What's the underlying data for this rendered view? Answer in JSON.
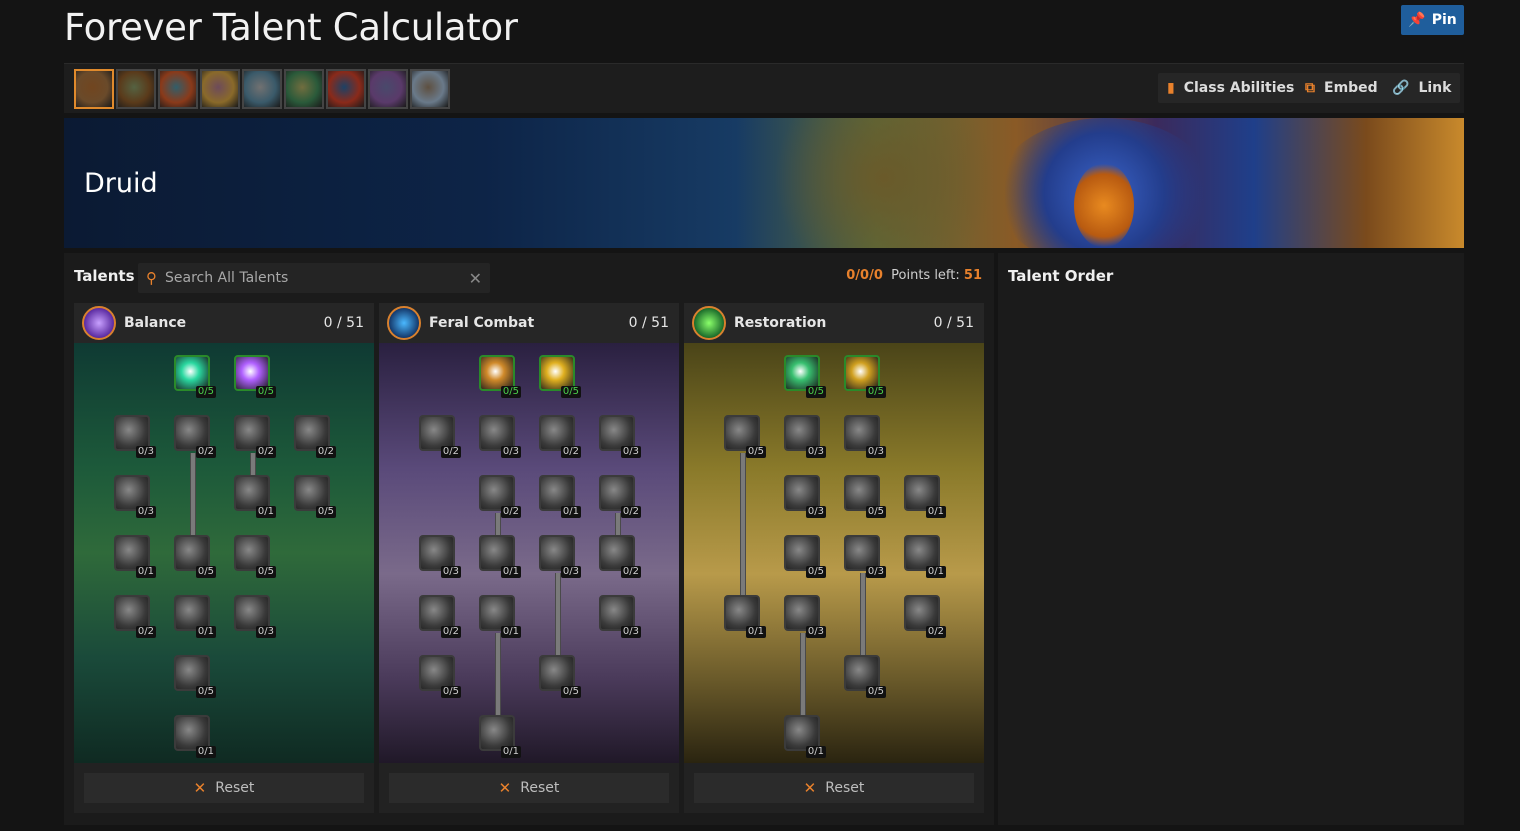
{
  "app": {
    "title": "Forever Talent Calculator",
    "pin_label": "Pin"
  },
  "toolbar": {
    "classes": [
      {
        "name": "Druid",
        "icon": "druid-class-icon",
        "color": "#ff7c0a",
        "selected": true
      },
      {
        "name": "Hunter",
        "icon": "hunter-class-icon",
        "color": "#aad372"
      },
      {
        "name": "Mage",
        "icon": "mage-class-icon",
        "color": "#3fc7eb"
      },
      {
        "name": "Paladin",
        "icon": "paladin-class-icon",
        "color": "#f48cba"
      },
      {
        "name": "Priest",
        "icon": "priest-class-icon",
        "color": "#ffffff"
      },
      {
        "name": "Rogue",
        "icon": "rogue-class-icon",
        "color": "#fff468"
      },
      {
        "name": "Shaman",
        "icon": "shaman-class-icon",
        "color": "#0070dd"
      },
      {
        "name": "Warlock",
        "icon": "warlock-class-icon",
        "color": "#8788ee"
      },
      {
        "name": "Warrior",
        "icon": "warrior-class-icon",
        "color": "#c69b6d"
      }
    ],
    "class_abilities_label": "Class Abilities",
    "embed_label": "Embed",
    "link_label": "Link"
  },
  "banner": {
    "class_name": "Druid"
  },
  "talents": {
    "label": "Talents",
    "search_placeholder": "Search All Talents",
    "spent": "0/0/0",
    "points_left_label": "Points left:",
    "points_left": "51"
  },
  "order": {
    "label": "Talent Order"
  },
  "trees": [
    {
      "name": "Balance",
      "points": "0 / 51",
      "reset_label": "Reset",
      "icon": "balance-icon",
      "talents": [
        {
          "id": "b1",
          "rank": "0/5",
          "icon": "starlight-wrath-icon",
          "hi": true
        },
        {
          "id": "b2",
          "rank": "0/5",
          "icon": "genesis-icon",
          "hi": true
        },
        {
          "id": "b3",
          "rank": "0/3",
          "icon": "moonglow-icon"
        },
        {
          "id": "b4",
          "rank": "0/2",
          "icon": "natures-reach-icon"
        },
        {
          "id": "b5",
          "rank": "0/2",
          "icon": "improved-moonfire-icon"
        },
        {
          "id": "b6",
          "rank": "0/2",
          "icon": "brambles-icon"
        },
        {
          "id": "b7",
          "rank": "0/3",
          "icon": "natures-grasp-icon"
        },
        {
          "id": "b8",
          "rank": "0/1",
          "icon": "improved-natures-grasp-icon"
        },
        {
          "id": "b9",
          "rank": "0/5",
          "icon": "improved-entangling-roots-icon"
        },
        {
          "id": "b10",
          "rank": "0/1",
          "icon": "insect-swarm-icon"
        },
        {
          "id": "b11",
          "rank": "0/5",
          "icon": "natures-focus-icon"
        },
        {
          "id": "b12",
          "rank": "0/5",
          "icon": "vengeance-icon"
        },
        {
          "id": "b13",
          "rank": "0/2",
          "icon": "celestial-focus-icon"
        },
        {
          "id": "b14",
          "rank": "0/1",
          "icon": "lunar-guidance-icon"
        },
        {
          "id": "b15",
          "rank": "0/3",
          "icon": "moonfury-icon"
        },
        {
          "id": "b16",
          "rank": "0/5",
          "icon": "balance-of-power-icon"
        },
        {
          "id": "b17",
          "rank": "0/1",
          "icon": "moonkin-form-icon"
        }
      ]
    },
    {
      "name": "Feral Combat",
      "points": "0 / 51",
      "reset_label": "Reset",
      "icon": "feral-icon",
      "talents": [
        {
          "id": "f1",
          "rank": "0/5",
          "icon": "ferocity-icon",
          "hi": true
        },
        {
          "id": "f2",
          "rank": "0/5",
          "icon": "feral-aggression-icon",
          "hi": true
        },
        {
          "id": "f3",
          "rank": "0/2",
          "icon": "feral-instinct-icon"
        },
        {
          "id": "f4",
          "rank": "0/3",
          "icon": "brutal-impact-icon"
        },
        {
          "id": "f5",
          "rank": "0/2",
          "icon": "thick-hide-icon"
        },
        {
          "id": "f6",
          "rank": "0/3",
          "icon": "feline-swiftness-icon"
        },
        {
          "id": "f7",
          "rank": "0/2",
          "icon": "feral-charge-icon"
        },
        {
          "id": "f8",
          "rank": "0/1",
          "icon": "sharpened-claws-icon"
        },
        {
          "id": "f9",
          "rank": "0/2",
          "icon": "shredding-attacks-icon"
        },
        {
          "id": "f10",
          "rank": "0/3",
          "icon": "predatory-strikes-icon"
        },
        {
          "id": "f11",
          "rank": "0/1",
          "icon": "primal-fury-icon"
        },
        {
          "id": "f12",
          "rank": "0/3",
          "icon": "savage-fury-icon"
        },
        {
          "id": "f13",
          "rank": "0/2",
          "icon": "faerie-fire-feral-icon"
        },
        {
          "id": "f14",
          "rank": "0/2",
          "icon": "nurturing-instinct-icon"
        },
        {
          "id": "f15",
          "rank": "0/1",
          "icon": "heart-of-the-wild-icon"
        },
        {
          "id": "f16",
          "rank": "0/3",
          "icon": "survival-of-the-fittest-icon"
        },
        {
          "id": "f17",
          "rank": "0/5",
          "icon": "primal-tenacity-icon"
        },
        {
          "id": "f18",
          "rank": "0/5",
          "icon": "leader-of-the-pack-icon"
        },
        {
          "id": "f19",
          "rank": "0/1",
          "icon": "mangle-icon"
        }
      ]
    },
    {
      "name": "Restoration",
      "points": "0 / 51",
      "reset_label": "Reset",
      "icon": "restoration-icon",
      "talents": [
        {
          "id": "r1",
          "rank": "0/5",
          "icon": "improved-mark-of-the-wild-icon",
          "hi": true
        },
        {
          "id": "r2",
          "rank": "0/5",
          "icon": "furor-icon",
          "hi": true
        },
        {
          "id": "r3",
          "rank": "0/5",
          "icon": "naturalist-icon"
        },
        {
          "id": "r4",
          "rank": "0/3",
          "icon": "natures-focus-resto-icon"
        },
        {
          "id": "r5",
          "rank": "0/3",
          "icon": "natural-shapeshifter-icon"
        },
        {
          "id": "r6",
          "rank": "0/3",
          "icon": "intensity-icon"
        },
        {
          "id": "r7",
          "rank": "0/5",
          "icon": "subtlety-icon"
        },
        {
          "id": "r8",
          "rank": "0/1",
          "icon": "omen-of-clarity-icon"
        },
        {
          "id": "r9",
          "rank": "0/5",
          "icon": "tranquil-spirit-icon"
        },
        {
          "id": "r10",
          "rank": "0/3",
          "icon": "improved-rejuvenation-icon"
        },
        {
          "id": "r11",
          "rank": "0/1",
          "icon": "natures-swiftness-icon"
        },
        {
          "id": "r12",
          "rank": "0/1",
          "icon": "gift-of-nature-icon"
        },
        {
          "id": "r13",
          "rank": "0/3",
          "icon": "improved-tranquility-icon"
        },
        {
          "id": "r14",
          "rank": "0/2",
          "icon": "empowered-touch-icon"
        },
        {
          "id": "r15",
          "rank": "0/5",
          "icon": "improved-regrowth-icon"
        },
        {
          "id": "r16",
          "rank": "0/1",
          "icon": "swiftmend-icon"
        }
      ]
    }
  ]
}
